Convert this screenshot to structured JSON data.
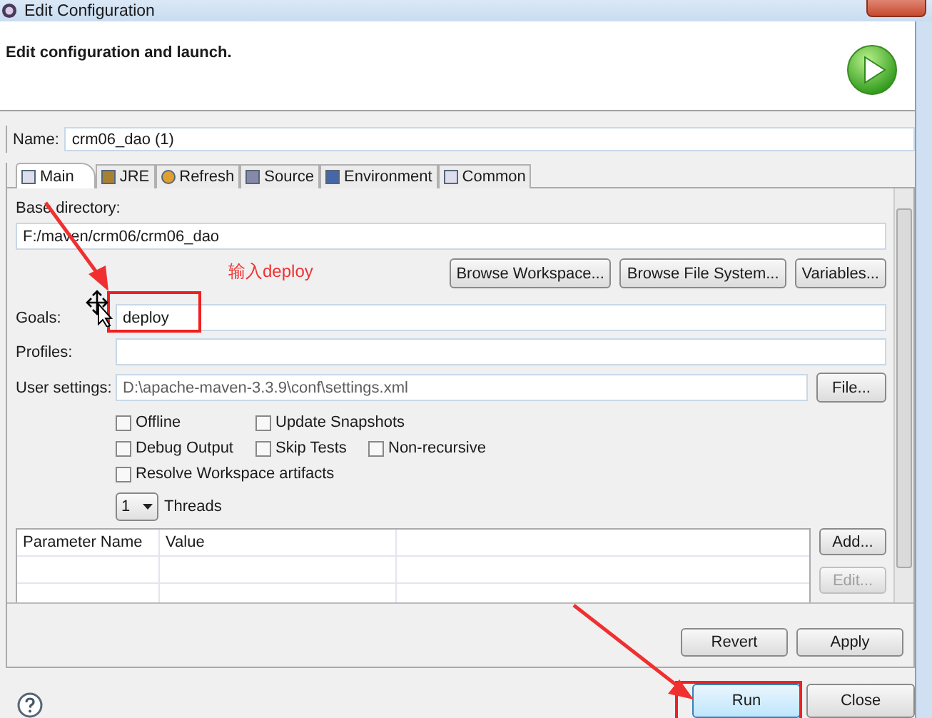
{
  "window": {
    "title": "Edit Configuration"
  },
  "header": {
    "message": "Edit configuration and launch."
  },
  "name": {
    "label": "Name:",
    "value": "crm06_dao (1)"
  },
  "tabs": [
    {
      "label": "Main",
      "selected": true
    },
    {
      "label": "JRE",
      "selected": false
    },
    {
      "label": "Refresh",
      "selected": false
    },
    {
      "label": "Source",
      "selected": false
    },
    {
      "label": "Environment",
      "selected": false
    },
    {
      "label": "Common",
      "selected": false
    }
  ],
  "main": {
    "base_directory": {
      "label": "Base directory:",
      "value": "F:/maven/crm06/crm06_dao"
    },
    "browse_buttons": [
      "Browse Workspace...",
      "Browse File System...",
      "Variables..."
    ],
    "goals": {
      "label": "Goals:",
      "value": "deploy"
    },
    "profiles": {
      "label": "Profiles:"
    },
    "user_settings": {
      "label": "User settings:",
      "value": "D:\\apache-maven-3.3.9\\conf\\settings.xml",
      "button": "File..."
    },
    "options": [
      [
        {
          "label": "Offline",
          "checked": false
        },
        {
          "label": "Update Snapshots",
          "checked": false
        }
      ],
      [
        {
          "label": "Debug Output",
          "checked": false
        },
        {
          "label": "Skip Tests",
          "checked": false
        },
        {
          "label": "Non-recursive",
          "checked": false
        }
      ],
      [
        {
          "label": "Resolve Workspace artifacts",
          "checked": false
        }
      ]
    ],
    "threads": {
      "value": "1",
      "label": "Threads"
    },
    "parameters": {
      "columns": [
        "Parameter Name",
        "Value"
      ],
      "buttons": [
        {
          "label": "Add...",
          "disabled": false
        },
        {
          "label": "Edit...",
          "disabled": true
        }
      ]
    }
  },
  "actions": [
    {
      "label": "Revert",
      "disabled": false
    },
    {
      "label": "Apply",
      "disabled": false
    }
  ],
  "footer": {
    "buttons": [
      "Run",
      "Close"
    ]
  },
  "annotation": {
    "text": "输入deploy"
  }
}
